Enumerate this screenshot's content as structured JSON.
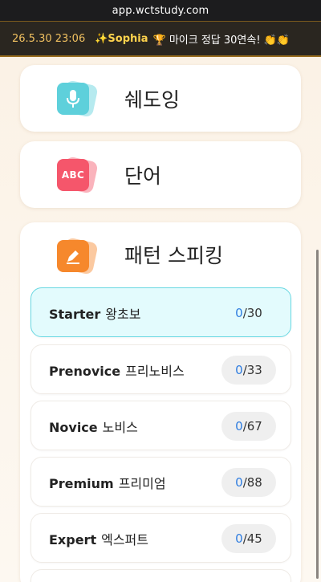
{
  "browser": {
    "url": "app.wctstudy.com"
  },
  "ticker": {
    "timestamp": "26.5.30 23:06",
    "user": "✨Sophia",
    "message": "🏆 마이크 정답 30연속! 👏👏"
  },
  "menu": {
    "shadowing": "쉐도잉",
    "vocab": "단어",
    "vocab_icon_text": "ABC",
    "pattern": "패턴 스피킹"
  },
  "levels": [
    {
      "name": "Starter",
      "ko": "왕초보",
      "current": "0",
      "total": "/30"
    },
    {
      "name": "Prenovice",
      "ko": "프리노비스",
      "current": "0",
      "total": "/33"
    },
    {
      "name": "Novice",
      "ko": "노비스",
      "current": "0",
      "total": "/67"
    },
    {
      "name": "Premium",
      "ko": "프리미엄",
      "current": "0",
      "total": "/88"
    },
    {
      "name": "Expert",
      "ko": "엑스퍼트",
      "current": "0",
      "total": "/45"
    }
  ],
  "colors": {
    "accent_active": "#69d8e2",
    "progress_current": "#2f7de0",
    "shadowing_icon": "#5ed0db",
    "vocab_icon": "#f5566b",
    "pattern_icon": "#f6882c"
  }
}
